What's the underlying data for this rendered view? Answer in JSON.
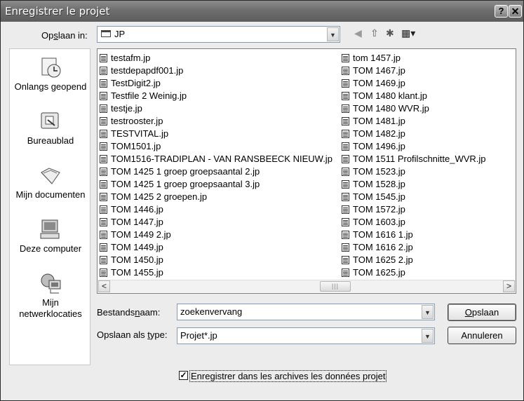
{
  "window": {
    "title": "Enregistrer le projet",
    "help_btn": "?",
    "close_btn": "✕"
  },
  "location": {
    "label_pre": "Op",
    "label_acc": "s",
    "label_post": "laan in:",
    "value": "JP"
  },
  "toolbar": {
    "back": "◀",
    "up": "⇧",
    "new_folder": "✱",
    "views": "▦▾",
    "back_icon": "back-icon",
    "up_icon": "up-folder-icon",
    "new_folder_icon": "new-folder-icon",
    "views_icon": "views-menu-icon"
  },
  "places": [
    {
      "label": "Onlangs geopend",
      "icon": "recent-icon"
    },
    {
      "label": "Bureaublad",
      "icon": "desktop-icon"
    },
    {
      "label": "Mijn documenten",
      "icon": "my-documents-icon"
    },
    {
      "label": "Deze computer",
      "icon": "my-computer-icon"
    },
    {
      "label": "Mijn netwerklocaties",
      "icon": "network-icon"
    }
  ],
  "files_col1": [
    "testafm.jp",
    "testdepapdf001.jp",
    "TestDigit2.jp",
    "Testfile 2 Weinig.jp",
    "testje.jp",
    "testrooster.jp",
    "TESTVITAL.jp",
    "TOM1501.jp",
    "TOM1516-TRADIPLAN - VAN RANSBEECK NIEUW.jp",
    "TOM 1425 1 groep groepsaantal 2.jp",
    "TOM 1425 1 groep groepsaantal 3.jp",
    "TOM 1425 2 groepen.jp",
    "TOM 1446.jp",
    "TOM 1447.jp",
    "TOM 1449 2.jp",
    "TOM 1449.jp",
    "TOM 1450.jp",
    "TOM 1455.jp"
  ],
  "files_col2": [
    "tom 1457.jp",
    "TOM 1467.jp",
    "TOM 1469.jp",
    "TOM 1480 klant.jp",
    "TOM 1480 WVR.jp",
    "TOM 1481.jp",
    "TOM 1482.jp",
    "TOM 1496.jp",
    "TOM 1511 Profilschnitte_WVR.jp",
    "TOM 1523.jp",
    "TOM 1528.jp",
    "TOM 1545.jp",
    "TOM 1572.jp",
    "TOM 1603.jp",
    "TOM 1616 1.jp",
    "TOM 1616 2.jp",
    "TOM 1625 2.jp",
    "TOM 1625.jp"
  ],
  "scroll": {
    "left": "<",
    "right": ">",
    "grip": "|||"
  },
  "filename": {
    "label_pre": "Bestands",
    "label_acc": "n",
    "label_post": "aam:",
    "value": "zoekenvervang"
  },
  "filetype": {
    "label_pre": "Opslaan als ",
    "label_acc": "t",
    "label_post": "ype:",
    "value": "Projet*.jp"
  },
  "buttons": {
    "save_acc": "O",
    "save_rest": "pslaan",
    "cancel": "Annuleren"
  },
  "archive": {
    "checked": "✓",
    "label": "Enregistrer dans les archives les données projet"
  }
}
